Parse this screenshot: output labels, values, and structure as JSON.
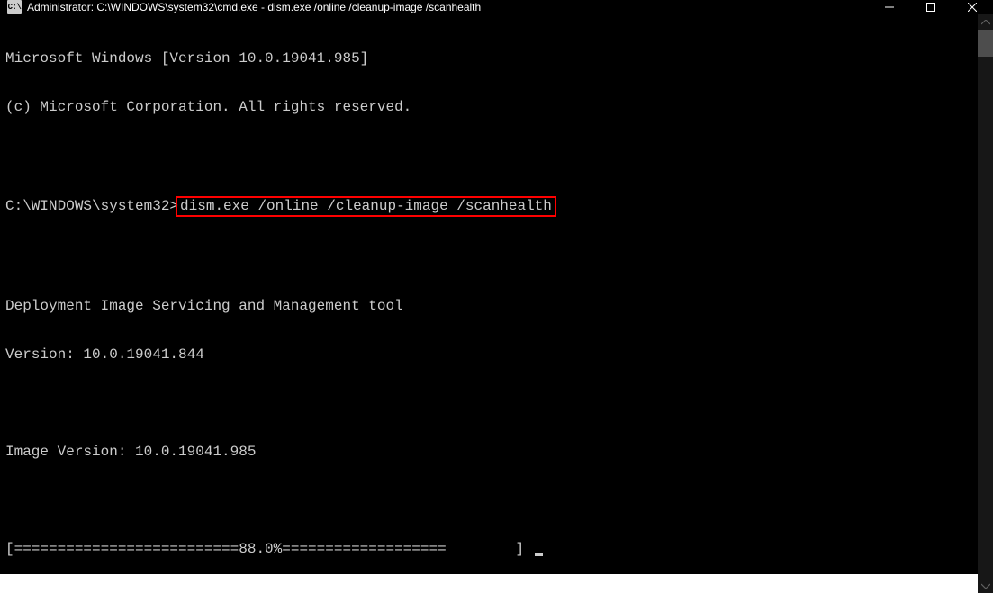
{
  "titlebar": {
    "icon_text": "C:\\",
    "title": "Administrator: C:\\WINDOWS\\system32\\cmd.exe - dism.exe  /online /cleanup-image /scanhealth"
  },
  "terminal": {
    "line1": "Microsoft Windows [Version 10.0.19041.985]",
    "line2": "(c) Microsoft Corporation. All rights reserved.",
    "prompt": "C:\\WINDOWS\\system32>",
    "command": "dism.exe /online /cleanup-image /scanhealth",
    "tool_name": "Deployment Image Servicing and Management tool",
    "tool_version": "Version: 10.0.19041.844",
    "image_version": "Image Version: 10.0.19041.985",
    "progress_line": "[==========================88.0%===================        ] "
  }
}
